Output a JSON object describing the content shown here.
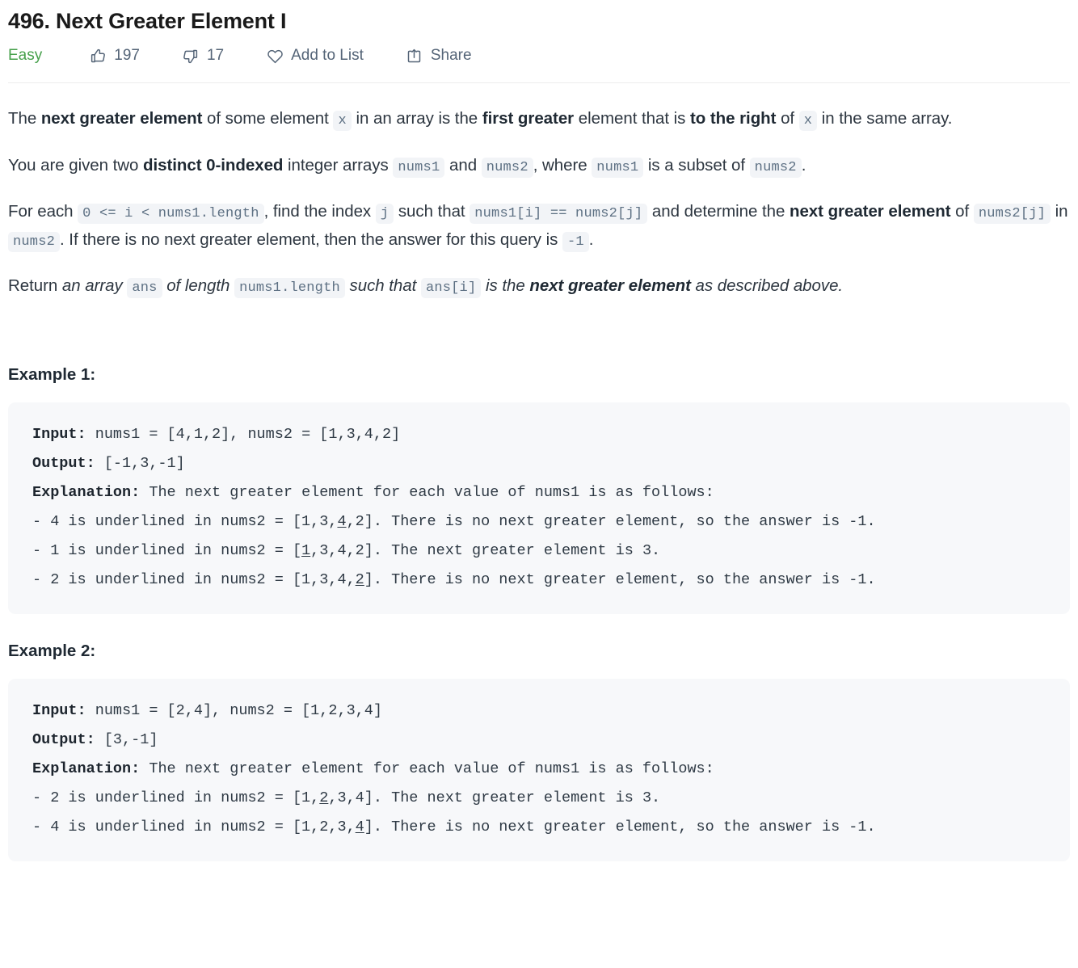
{
  "header": {
    "title": "496. Next Greater Element I",
    "difficulty": "Easy",
    "difficulty_color": "#46a04b",
    "likes": "197",
    "dislikes": "17",
    "add_to_list_label": "Add to List",
    "share_label": "Share"
  },
  "description": {
    "p1": {
      "t1": "The ",
      "b1": "next greater element",
      "t2": " of some element ",
      "c1": "x",
      "t3": " in an array is the ",
      "b2": "first greater",
      "t4": " element that is ",
      "b3": "to the right",
      "t5": " of ",
      "c2": "x",
      "t6": " in the same array."
    },
    "p2": {
      "t1": "You are given two ",
      "b1": "distinct 0-indexed",
      "t2": " integer arrays ",
      "c1": "nums1",
      "t3": " and ",
      "c2": "nums2",
      "t4": ", where ",
      "c3": "nums1",
      "t5": " is a subset of ",
      "c4": "nums2",
      "t6": "."
    },
    "p3": {
      "t1": "For each ",
      "c1": "0 <= i < nums1.length",
      "t2": ", find the index ",
      "c2": "j",
      "t3": " such that ",
      "c3": "nums1[i] == nums2[j]",
      "t4": " and determine the ",
      "b1": "next greater element",
      "t5": " of ",
      "c4": "nums2[j]",
      "t6": " in ",
      "c5": "nums2",
      "t7": ". If there is no next greater element, then the answer for this query is ",
      "c6": "-1",
      "t8": "."
    },
    "p4": {
      "t1": "Return ",
      "i1": "an array ",
      "c1": "ans",
      "i2": " of length ",
      "c2": "nums1.length",
      "i3": " such that ",
      "c3": "ans[i]",
      "i4": " is the ",
      "b1": "next greater element",
      "i5": " as described above."
    }
  },
  "examples": [
    {
      "heading": "Example 1:",
      "input_label": "Input:",
      "input_value": " nums1 = [4,1,2], nums2 = [1,3,4,2]",
      "output_label": "Output:",
      "output_value": " [-1,3,-1]",
      "explanation_label": "Explanation:",
      "explanation_value": " The next greater element for each value of nums1 is as follows:",
      "lines": [
        {
          "pre": "- 4 is underlined in nums2 = [1,3,",
          "underlined": "4",
          "post": ",2]. There is no next greater element, so the answer is -1."
        },
        {
          "pre": "- 1 is underlined in nums2 = [",
          "underlined": "1",
          "post": ",3,4,2]. The next greater element is 3."
        },
        {
          "pre": "- 2 is underlined in nums2 = [1,3,4,",
          "underlined": "2",
          "post": "]. There is no next greater element, so the answer is -1."
        }
      ]
    },
    {
      "heading": "Example 2:",
      "input_label": "Input:",
      "input_value": " nums1 = [2,4], nums2 = [1,2,3,4]",
      "output_label": "Output:",
      "output_value": " [3,-1]",
      "explanation_label": "Explanation:",
      "explanation_value": " The next greater element for each value of nums1 is as follows:",
      "lines": [
        {
          "pre": "- 2 is underlined in nums2 = [1,",
          "underlined": "2",
          "post": ",3,4]. The next greater element is 3."
        },
        {
          "pre": "- 4 is underlined in nums2 = [1,2,3,",
          "underlined": "4",
          "post": "]. There is no next greater element, so the answer is -1."
        }
      ]
    }
  ],
  "icons": {
    "like": "thumbs-up-icon",
    "dislike": "thumbs-down-icon",
    "add_to_list": "heart-icon",
    "share": "share-icon"
  }
}
